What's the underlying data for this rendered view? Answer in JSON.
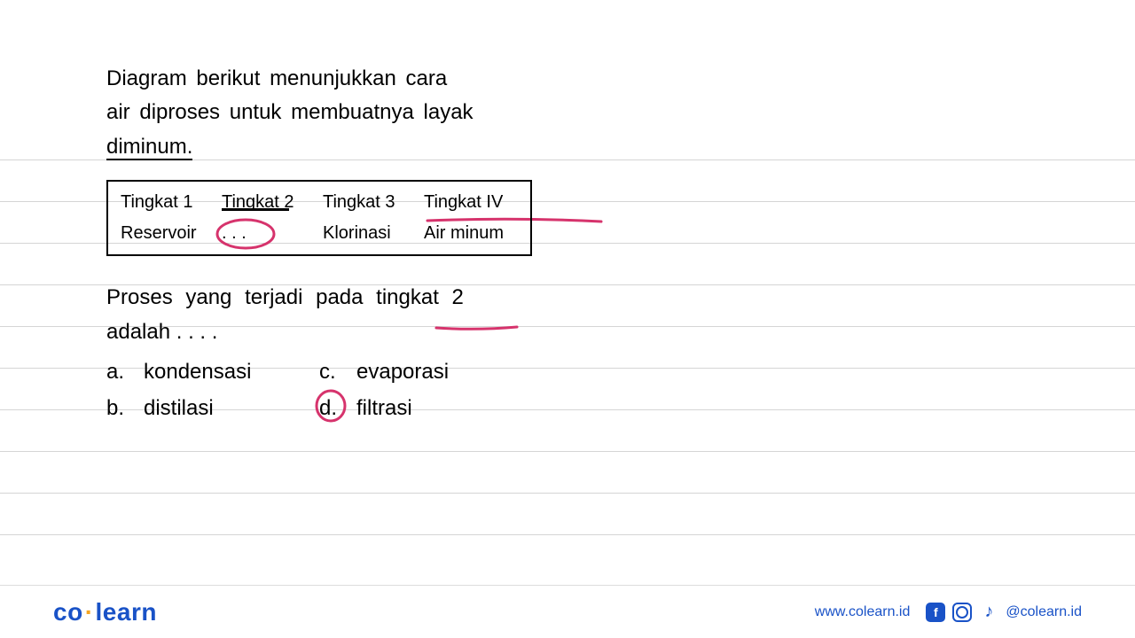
{
  "question": {
    "line1": "Diagram berikut menunjukkan cara",
    "line2": "air diproses untuk membuatnya layak",
    "line3": "diminum."
  },
  "table": {
    "headers": [
      "Tingkat 1",
      "Tingkat 2",
      "Tingkat 3",
      "Tingkat IV"
    ],
    "values": [
      "Reservoir",
      ". . .",
      "Klorinasi",
      "Air minum"
    ]
  },
  "question2": {
    "line1": "Proses yang terjadi pada tingkat 2",
    "line2": "adalah . . . ."
  },
  "options": {
    "a": {
      "label": "a.",
      "text": "kondensasi"
    },
    "b": {
      "label": "b.",
      "text": "distilasi"
    },
    "c": {
      "label": "c.",
      "text": "evaporasi"
    },
    "d": {
      "label": "d.",
      "text": "filtrasi"
    }
  },
  "footer": {
    "logo_co": "co",
    "logo_learn": "learn",
    "website": "www.colearn.id",
    "handle": "@colearn.id"
  },
  "annotations": {
    "stroke_color": "#d6336c"
  }
}
